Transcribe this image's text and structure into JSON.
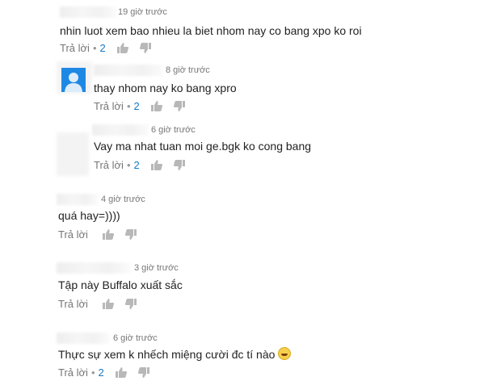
{
  "comments": [
    {
      "time": "19 giờ trước",
      "text": "nhin luot xem bao nhieu la biet nhom nay co bang xpo ko roi",
      "reply_label": "Trả lời",
      "likes": "2"
    },
    {
      "time": "8 giờ trước",
      "text": "thay nhom nay ko bang xpro",
      "reply_label": "Trả lời",
      "likes": "2"
    },
    {
      "time": "6 giờ trước",
      "text": "Vay ma nhat tuan moi ge.bgk ko cong bang",
      "reply_label": "Trả lời",
      "likes": "2"
    },
    {
      "time": "4 giờ trước",
      "text": "quá hay=))))",
      "reply_label": "Trả lời"
    },
    {
      "time": "3 giờ trước",
      "text": "Tập này Buffalo xuất sắc",
      "reply_label": "Trả lời"
    },
    {
      "time": "6 giờ trước",
      "text": "Thực sự xem k nhếch miệng cười đc tí nào",
      "reply_label": "Trả lời",
      "likes": "2"
    }
  ],
  "colors": {
    "link": "#167ac6",
    "meta": "#767676",
    "text": "#222222",
    "avatar": "#1e88e5"
  }
}
